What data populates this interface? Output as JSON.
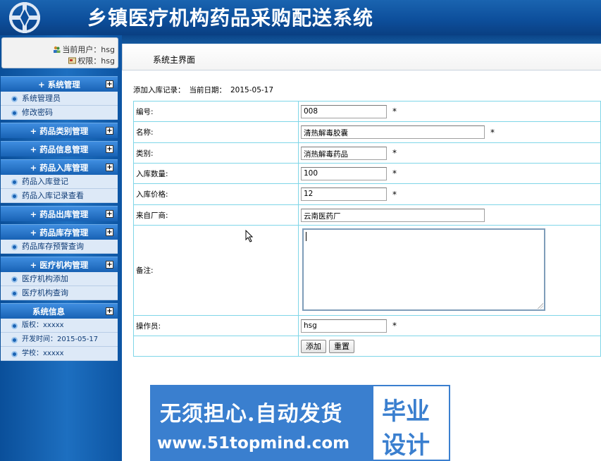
{
  "header": {
    "title": "乡镇医疗机构药品采购配送系统",
    "logo": "compass-cross-logo"
  },
  "user": {
    "current_user": "当前用户：hsg",
    "permission": "权限：hsg"
  },
  "menu": [
    {
      "title": "+ 系统管理",
      "items": [
        "系统管理员",
        "修改密码"
      ]
    },
    {
      "title": "+ 药品类别管理",
      "items": []
    },
    {
      "title": "+ 药品信息管理",
      "items": []
    },
    {
      "title": "+ 药品入库管理",
      "items": [
        "药品入库登记",
        "药品入库记录查看"
      ]
    },
    {
      "title": "+ 药品出库管理",
      "items": []
    },
    {
      "title": "+ 药品库存管理",
      "items": [
        "药品库存预警查询"
      ]
    },
    {
      "title": "+ 医疗机构管理",
      "items": [
        "医疗机构添加",
        "医疗机构查询"
      ]
    },
    {
      "title": "系统信息",
      "items": [
        "版权：xxxxx",
        "开发时间：2015-05-17",
        "学校：xxxxx"
      ]
    }
  ],
  "topbar": {
    "title": "系统主界面"
  },
  "caption": {
    "add_label": "添加入库记录：",
    "date_label": "当前日期：",
    "date": "2015-05-17"
  },
  "form": {
    "rows": [
      {
        "label": "编号:",
        "value": "008",
        "required": "*"
      },
      {
        "label": "名称:",
        "value": "清热解毒胶囊",
        "required": "*"
      },
      {
        "label": "类别:",
        "value": "消热解毒药品",
        "required": "*"
      },
      {
        "label": "入库数量:",
        "value": "100",
        "required": "*"
      },
      {
        "label": "入库价格:",
        "value": "12",
        "required": "*"
      },
      {
        "label": "来自厂商:",
        "value": "云南医药厂",
        "required": ""
      }
    ],
    "remark_label": "备注:",
    "operator_label": "操作员:",
    "operator_value": "hsg",
    "operator_required": "*",
    "add_button": "添加",
    "reset_button": "重置"
  },
  "watermark": {
    "line1": "无须担心.自动发货",
    "line2": "www.51topmind.com",
    "right1": "毕业",
    "right2": "设计"
  },
  "colors": {
    "header_blue": "#0d4f9c",
    "menu_blue": "#1862b4",
    "table_border": "#7fd6e8",
    "watermark_blue": "#3a7fcf"
  }
}
